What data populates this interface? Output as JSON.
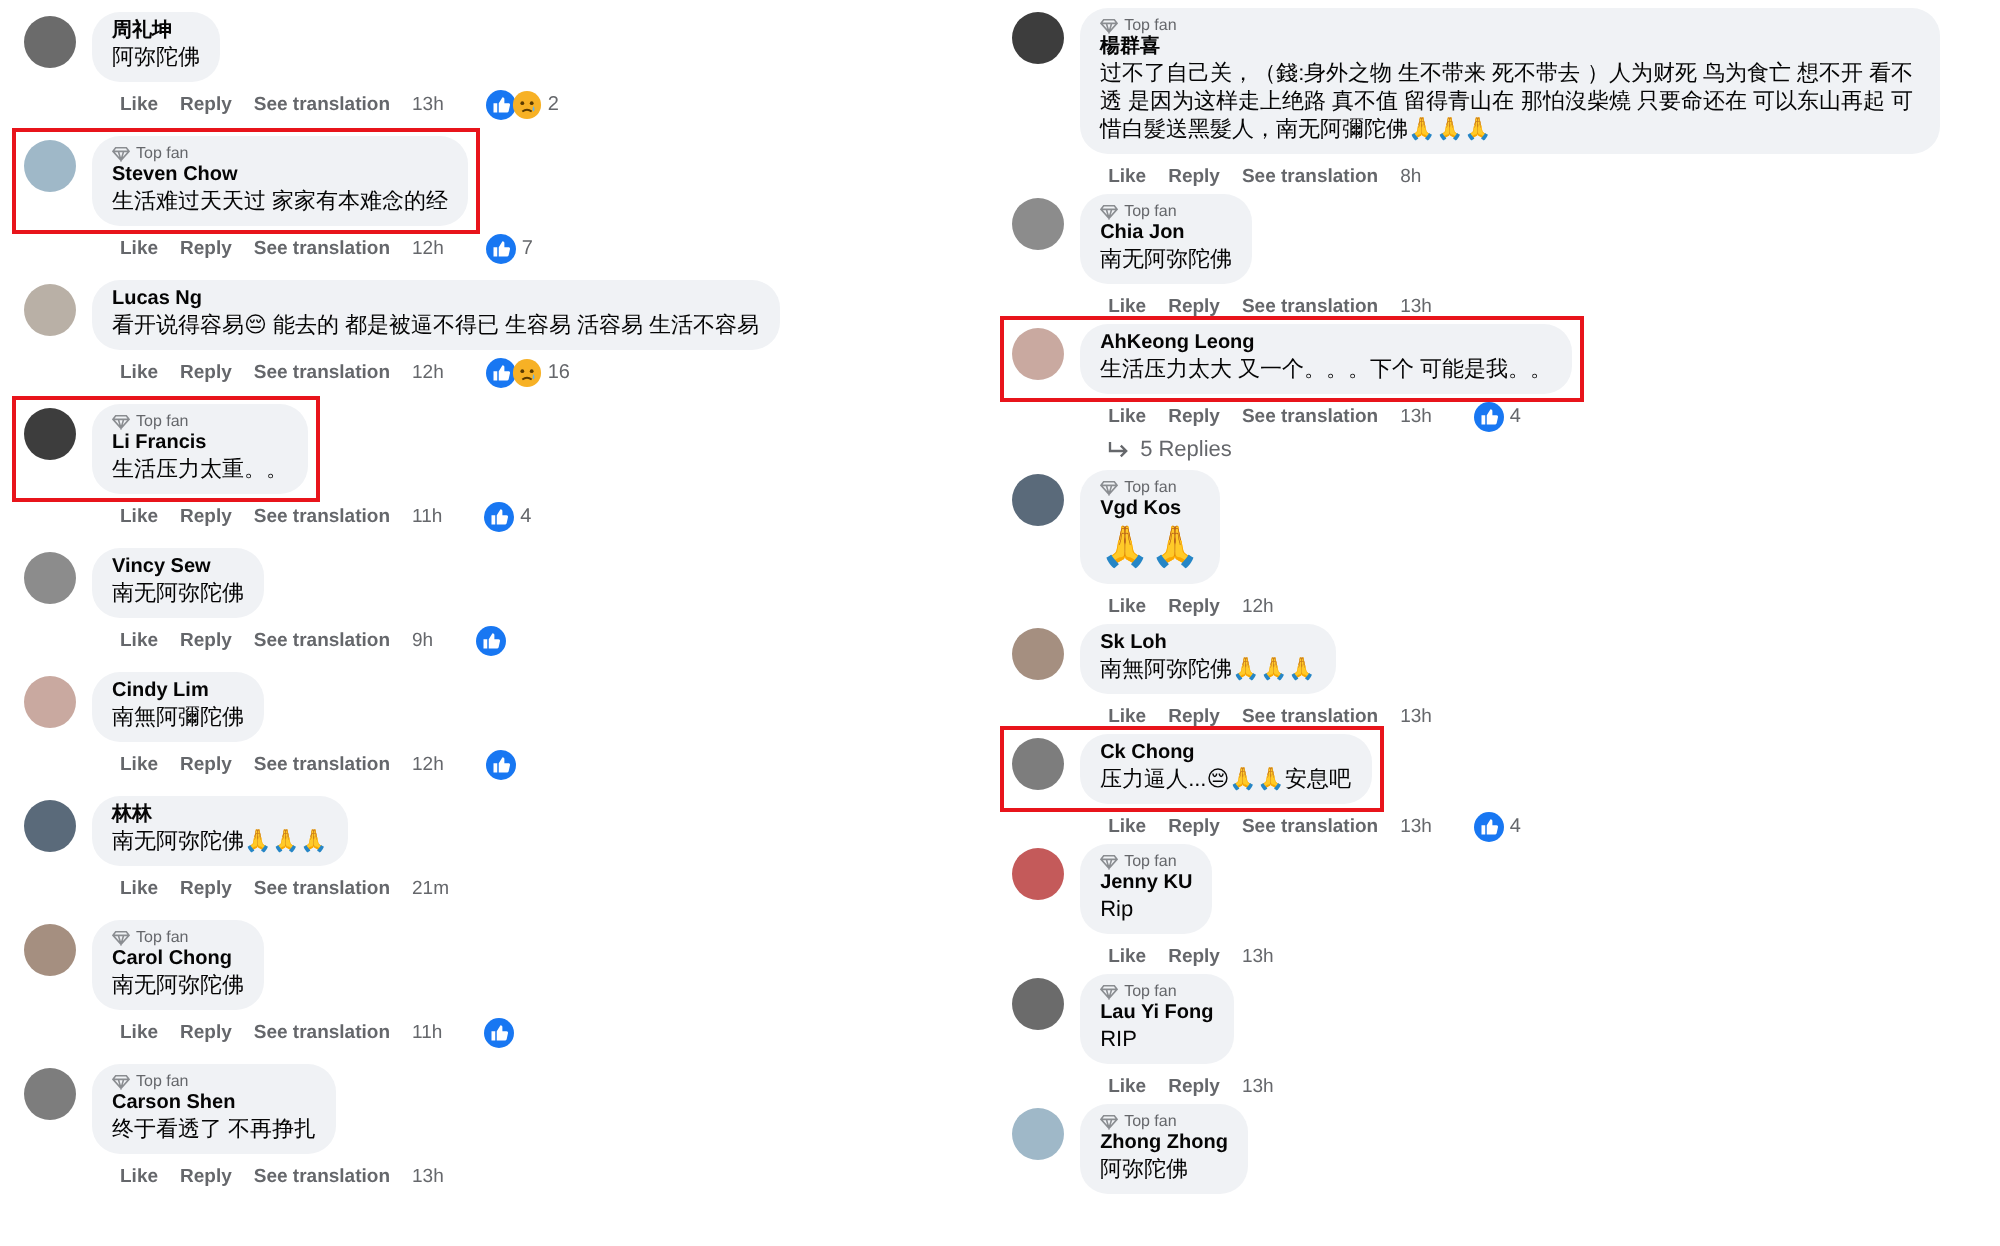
{
  "columns": [
    {
      "comments": [
        {
          "name": "周礼坤",
          "text": "阿弥陀佛",
          "highlighted": false,
          "actions": [
            "Like",
            "Reply",
            "See translation"
          ],
          "time": "13h",
          "reactions": {
            "icons": [
              {
                "kind": "like"
              },
              {
                "kind": "sad"
              }
            ],
            "count": "2"
          }
        },
        {
          "badge": "Top fan",
          "name": "Steven Chow",
          "text": "生活难过天天过 家家有本难念的经",
          "highlighted": true,
          "actions": [
            "Like",
            "Reply",
            "See translation"
          ],
          "time": "12h",
          "reactions": {
            "icons": [
              {
                "kind": "like"
              }
            ],
            "count": "7"
          }
        },
        {
          "name": "Lucas Ng",
          "text": "看开说得容易😔 能去的 都是被逼不得已 生容易 活容易 生活不容易",
          "highlighted": false,
          "actions": [
            "Like",
            "Reply",
            "See translation"
          ],
          "time": "12h",
          "reactions": {
            "icons": [
              {
                "kind": "like"
              },
              {
                "kind": "sad"
              }
            ],
            "count": "16"
          }
        },
        {
          "badge": "Top fan",
          "name": "Li Francis",
          "text": "生活压力太重。。",
          "highlighted": true,
          "actions": [
            "Like",
            "Reply",
            "See translation"
          ],
          "time": "11h",
          "reactions": {
            "icons": [
              {
                "kind": "like"
              }
            ],
            "count": "4"
          }
        },
        {
          "name": "Vincy Sew",
          "text": "南无阿弥陀佛",
          "highlighted": false,
          "actions": [
            "Like",
            "Reply",
            "See translation"
          ],
          "time": "9h",
          "reactions": {
            "icons": [
              {
                "kind": "like"
              }
            ]
          }
        },
        {
          "name": "Cindy Lim",
          "text": "南無阿彌陀佛",
          "highlighted": false,
          "actions": [
            "Like",
            "Reply",
            "See translation"
          ],
          "time": "12h",
          "reactions": {
            "icons": [
              {
                "kind": "like"
              }
            ]
          }
        },
        {
          "name": "林林",
          "text": "南无阿弥陀佛🙏🙏🙏",
          "highlighted": false,
          "actions": [
            "Like",
            "Reply",
            "See translation"
          ],
          "time": "21m"
        },
        {
          "badge": "Top fan",
          "name": "Carol Chong",
          "text": "南无阿弥陀佛",
          "highlighted": false,
          "actions": [
            "Like",
            "Reply",
            "See translation"
          ],
          "time": "11h",
          "reactions": {
            "icons": [
              {
                "kind": "like"
              }
            ]
          }
        },
        {
          "badge": "Top fan",
          "name": "Carson Shen",
          "text": "终于看透了 不再挣扎",
          "highlighted": false,
          "actions": [
            "Like",
            "Reply",
            "See translation"
          ],
          "time": "13h"
        }
      ]
    },
    {
      "comments": [
        {
          "badge": "Top fan",
          "name": "楊群喜",
          "text": "过不了自己关，（錢:身外之物 生不带来 死不带去 ）人为财死 鸟为食亡 想不开 看不透 是因为这样走上绝路 真不值 留得青山在 那怕沒柴燒 只要命还在 可以东山再起 可惜白髮送黑髮人，南无阿彌陀佛🙏🙏🙏",
          "highlighted": false,
          "actions": [
            "Like",
            "Reply",
            "See translation"
          ],
          "time": "8h"
        },
        {
          "badge": "Top fan",
          "name": "Chia Jon",
          "text": "南无阿弥陀佛",
          "highlighted": false,
          "actions": [
            "Like",
            "Reply",
            "See translation"
          ],
          "time": "13h"
        },
        {
          "name": "AhKeong Leong",
          "text": "生活压力太大 又一个。。。下个 可能是我。。",
          "highlighted": true,
          "actions": [
            "Like",
            "Reply",
            "See translation"
          ],
          "time": "13h",
          "reactions": {
            "icons": [
              {
                "kind": "like"
              }
            ],
            "count": "4"
          },
          "replies_link": "5 Replies"
        },
        {
          "badge": "Top fan",
          "name": "Vgd Kos",
          "text": "🙏🙏",
          "large": true,
          "highlighted": false,
          "actions": [
            "Like",
            "Reply"
          ],
          "time": "12h"
        },
        {
          "name": "Sk Loh",
          "text": "南無阿弥陀佛🙏🙏🙏",
          "highlighted": false,
          "actions": [
            "Like",
            "Reply",
            "See translation"
          ],
          "time": "13h"
        },
        {
          "name": "Ck Chong",
          "text": "压力逼人...😔🙏🙏安息吧",
          "highlighted": true,
          "actions": [
            "Like",
            "Reply",
            "See translation"
          ],
          "time": "13h",
          "reactions": {
            "icons": [
              {
                "kind": "like"
              }
            ],
            "count": "4"
          }
        },
        {
          "badge": "Top fan",
          "name": "Jenny KU",
          "text": "Rip",
          "highlighted": false,
          "actions": [
            "Like",
            "Reply"
          ],
          "time": "13h"
        },
        {
          "badge": "Top fan",
          "name": "Lau Yi Fong",
          "text": "RIP",
          "highlighted": false,
          "actions": [
            "Like",
            "Reply"
          ],
          "time": "13h"
        },
        {
          "badge": "Top fan",
          "name": "Zhong Zhong",
          "text": "阿弥陀佛",
          "highlighted": false
        }
      ]
    }
  ]
}
